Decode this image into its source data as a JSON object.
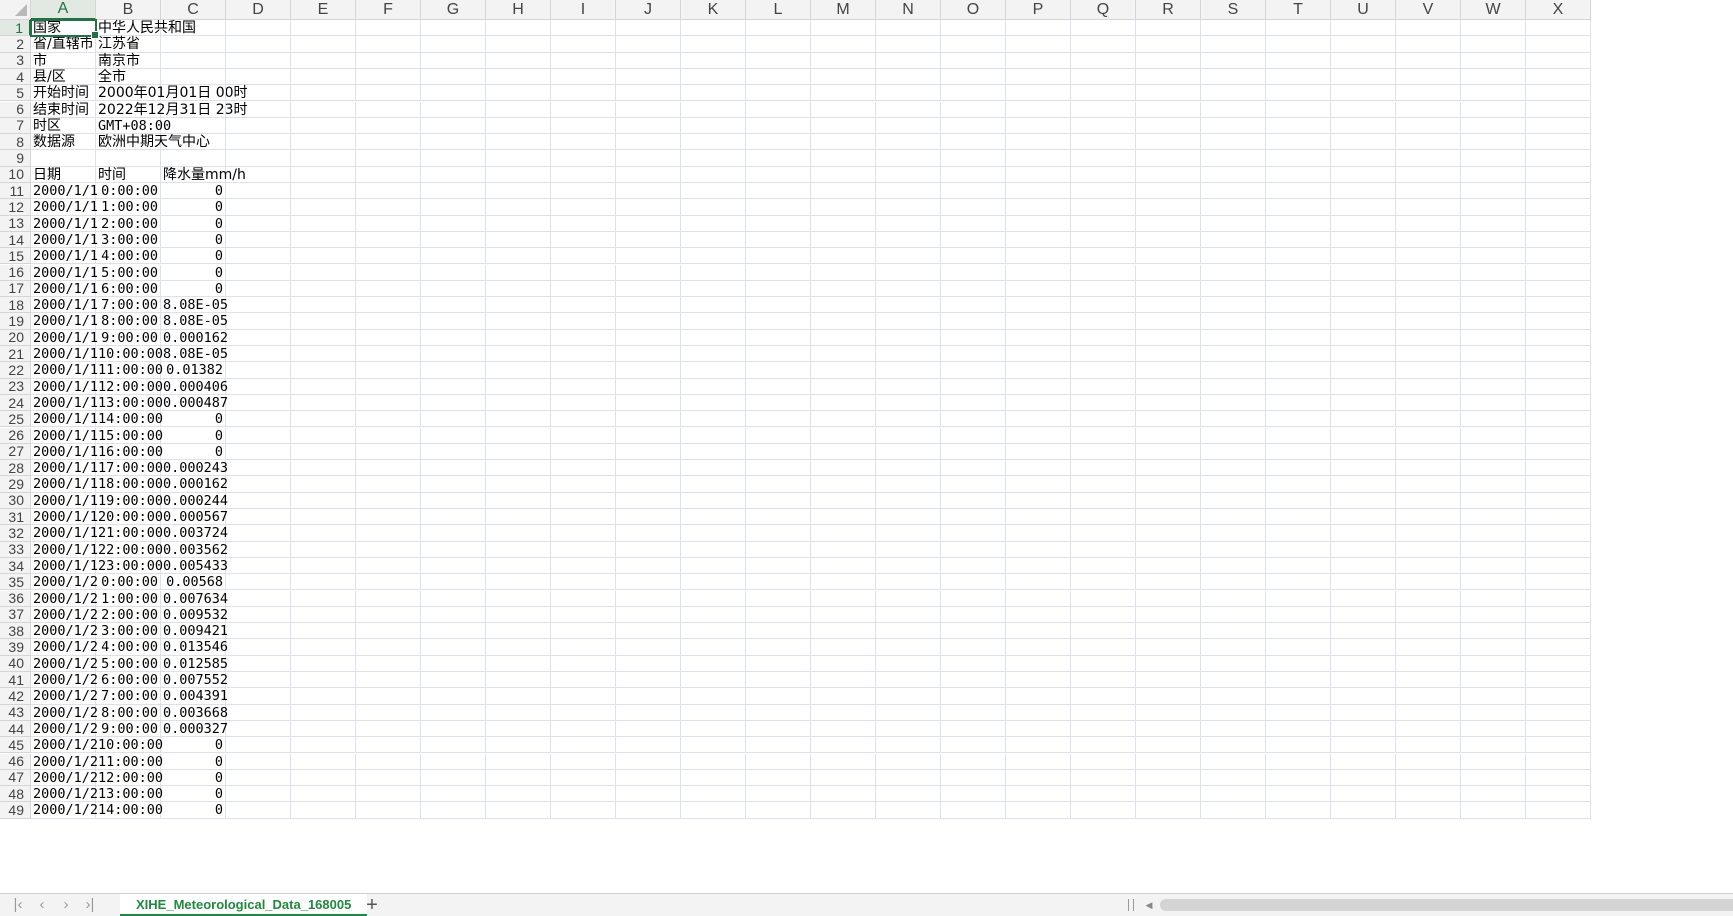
{
  "columns": [
    "A",
    "B",
    "C",
    "D",
    "E",
    "F",
    "G",
    "H",
    "I",
    "J",
    "K",
    "L",
    "M",
    "N",
    "O",
    "P",
    "Q",
    "R",
    "S",
    "T",
    "U",
    "V",
    "W",
    "X"
  ],
  "active_cell": "A1",
  "rows": [
    {
      "n": "1",
      "a": "国家",
      "b": "中华人民共和国",
      "c": ""
    },
    {
      "n": "2",
      "a": "省/直辖市",
      "b": "江苏省",
      "c": ""
    },
    {
      "n": "3",
      "a": "市",
      "b": "南京市",
      "c": ""
    },
    {
      "n": "4",
      "a": "县/区",
      "b": "全市",
      "c": ""
    },
    {
      "n": "5",
      "a": "开始时间",
      "b": "2000年01月01日 00时",
      "c": ""
    },
    {
      "n": "6",
      "a": "结束时间",
      "b": "2022年12月31日 23时",
      "c": ""
    },
    {
      "n": "7",
      "a": "时区",
      "b": "GMT+08:00",
      "c": ""
    },
    {
      "n": "8",
      "a": "数据源",
      "b": "欧洲中期天气中心",
      "c": ""
    },
    {
      "n": "9",
      "a": "",
      "b": "",
      "c": ""
    },
    {
      "n": "10",
      "a": "日期",
      "b": "时间",
      "c": "降水量mm/h"
    },
    {
      "n": "11",
      "a": "2000/1/1",
      "b": "0:00:00",
      "c": "0"
    },
    {
      "n": "12",
      "a": "2000/1/1",
      "b": "1:00:00",
      "c": "0"
    },
    {
      "n": "13",
      "a": "2000/1/1",
      "b": "2:00:00",
      "c": "0"
    },
    {
      "n": "14",
      "a": "2000/1/1",
      "b": "3:00:00",
      "c": "0"
    },
    {
      "n": "15",
      "a": "2000/1/1",
      "b": "4:00:00",
      "c": "0"
    },
    {
      "n": "16",
      "a": "2000/1/1",
      "b": "5:00:00",
      "c": "0"
    },
    {
      "n": "17",
      "a": "2000/1/1",
      "b": "6:00:00",
      "c": "0"
    },
    {
      "n": "18",
      "a": "2000/1/1",
      "b": "7:00:00",
      "c": "8.08E-05"
    },
    {
      "n": "19",
      "a": "2000/1/1",
      "b": "8:00:00",
      "c": "8.08E-05"
    },
    {
      "n": "20",
      "a": "2000/1/1",
      "b": "9:00:00",
      "c": "0.000162"
    },
    {
      "n": "21",
      "a": "2000/1/1",
      "b": "10:00:00",
      "c": "8.08E-05"
    },
    {
      "n": "22",
      "a": "2000/1/1",
      "b": "11:00:00",
      "c": "0.01382"
    },
    {
      "n": "23",
      "a": "2000/1/1",
      "b": "12:00:00",
      "c": "0.000406"
    },
    {
      "n": "24",
      "a": "2000/1/1",
      "b": "13:00:00",
      "c": "0.000487"
    },
    {
      "n": "25",
      "a": "2000/1/1",
      "b": "14:00:00",
      "c": "0"
    },
    {
      "n": "26",
      "a": "2000/1/1",
      "b": "15:00:00",
      "c": "0"
    },
    {
      "n": "27",
      "a": "2000/1/1",
      "b": "16:00:00",
      "c": "0"
    },
    {
      "n": "28",
      "a": "2000/1/1",
      "b": "17:00:00",
      "c": "0.000243"
    },
    {
      "n": "29",
      "a": "2000/1/1",
      "b": "18:00:00",
      "c": "0.000162"
    },
    {
      "n": "30",
      "a": "2000/1/1",
      "b": "19:00:00",
      "c": "0.000244"
    },
    {
      "n": "31",
      "a": "2000/1/1",
      "b": "20:00:00",
      "c": "0.000567"
    },
    {
      "n": "32",
      "a": "2000/1/1",
      "b": "21:00:00",
      "c": "0.003724"
    },
    {
      "n": "33",
      "a": "2000/1/1",
      "b": "22:00:00",
      "c": "0.003562"
    },
    {
      "n": "34",
      "a": "2000/1/1",
      "b": "23:00:00",
      "c": "0.005433"
    },
    {
      "n": "35",
      "a": "2000/1/2",
      "b": "0:00:00",
      "c": "0.00568"
    },
    {
      "n": "36",
      "a": "2000/1/2",
      "b": "1:00:00",
      "c": "0.007634"
    },
    {
      "n": "37",
      "a": "2000/1/2",
      "b": "2:00:00",
      "c": "0.009532"
    },
    {
      "n": "38",
      "a": "2000/1/2",
      "b": "3:00:00",
      "c": "0.009421"
    },
    {
      "n": "39",
      "a": "2000/1/2",
      "b": "4:00:00",
      "c": "0.013546"
    },
    {
      "n": "40",
      "a": "2000/1/2",
      "b": "5:00:00",
      "c": "0.012585"
    },
    {
      "n": "41",
      "a": "2000/1/2",
      "b": "6:00:00",
      "c": "0.007552"
    },
    {
      "n": "42",
      "a": "2000/1/2",
      "b": "7:00:00",
      "c": "0.004391"
    },
    {
      "n": "43",
      "a": "2000/1/2",
      "b": "8:00:00",
      "c": "0.003668"
    },
    {
      "n": "44",
      "a": "2000/1/2",
      "b": "9:00:00",
      "c": "0.000327"
    },
    {
      "n": "45",
      "a": "2000/1/2",
      "b": "10:00:00",
      "c": "0"
    },
    {
      "n": "46",
      "a": "2000/1/2",
      "b": "11:00:00",
      "c": "0"
    },
    {
      "n": "47",
      "a": "2000/1/2",
      "b": "12:00:00",
      "c": "0"
    },
    {
      "n": "48",
      "a": "2000/1/2",
      "b": "13:00:00",
      "c": "0"
    },
    {
      "n": "49",
      "a": "2000/1/2",
      "b": "14:00:00",
      "c": "0"
    }
  ],
  "sheet_tab": {
    "label": "XIHE_Meteorological_Data_168005"
  },
  "nav": {
    "first": "|‹",
    "prev": "‹",
    "next": "›",
    "last": "›|",
    "add": "+"
  },
  "icons": {
    "corner": "select-all-triangle-icon",
    "first": "first-sheet-icon",
    "prev": "prev-sheet-icon",
    "next": "next-sheet-icon",
    "last": "last-sheet-icon",
    "add": "add-sheet-icon",
    "scroll_left": "scroll-left-icon"
  },
  "colors": {
    "accent": "#217346",
    "tab_text": "#1e8a3e",
    "grid": "#dde1ea",
    "header_bg": "#f3f3f3"
  }
}
